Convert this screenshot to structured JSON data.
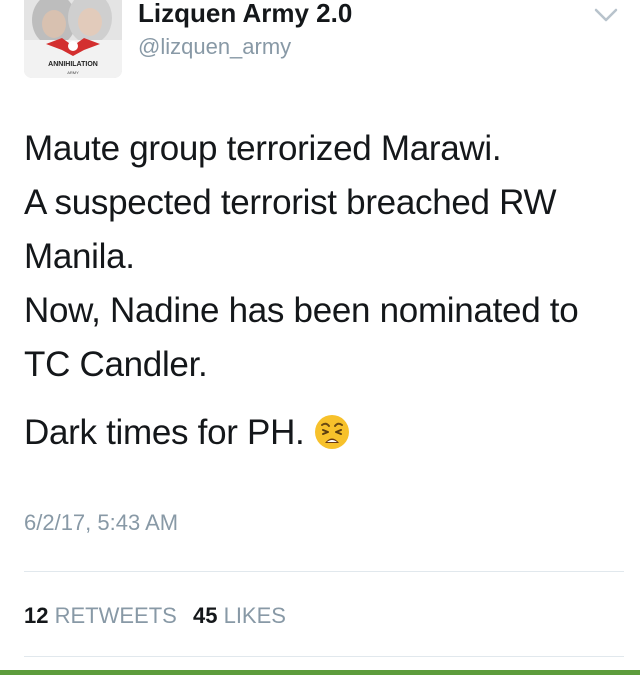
{
  "header": {
    "display_name": "Lizquen Army 2.0",
    "username": "@lizquen_army",
    "avatar_text": "ANNIHILATION",
    "avatar_subtext": "ARMY",
    "avatar_icon": "avatar",
    "menu_icon": "chevron-down-icon"
  },
  "tweet": {
    "lines": [
      "Maute group terrorized Marawi.",
      "A suspected terrorist breached RW Manila.",
      "Now, Nadine has been nominated to TC Candler.",
      "Dark times for PH."
    ],
    "emoji_icon": "weary-face-icon",
    "timestamp": "6/2/17, 5:43 AM"
  },
  "stats": {
    "retweets_count": "12",
    "retweets_label": "RETWEETS",
    "likes_count": "45",
    "likes_label": "LIKES"
  },
  "colors": {
    "name": "#14171a",
    "secondary": "#8899a6",
    "divider": "#e1e8ed",
    "bottom_strip": "#5d9c3c",
    "emoji": "#f7c12b"
  }
}
